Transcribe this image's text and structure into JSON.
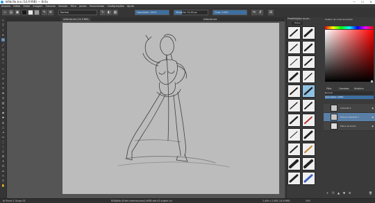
{
  "window": {
    "title": "rb9bc9a.kra (14,9 MiB) — Krita",
    "minimize": "—",
    "maximize": "☐",
    "close": "✕"
  },
  "menu": [
    "Arquivo",
    "Editar",
    "Exibir",
    "Imagem",
    "Camada",
    "Seleção",
    "Filtro",
    "Janela",
    "Ferramentas",
    "Configurações",
    "Ajuda"
  ],
  "toolbar": {
    "blend_mode": "Normal",
    "opacity": {
      "label": "Opacidade: 100%",
      "value": 1.0
    },
    "size": {
      "label": "Tamanho: 10,00 px",
      "value": 0.22
    },
    "flow": {
      "label": "Fluxo: 100%",
      "value": 1.0
    }
  },
  "tabs": [
    {
      "label": "rb9bc9a.kra (14,9 MiB)"
    },
    {
      "label": "rb9bc9a.kra"
    }
  ],
  "brush_panel": {
    "title": "Predefinições de pin...",
    "tag": "Todos"
  },
  "color_panel": {
    "title": "Seletor de cores avançado",
    "accent": "#ff0000"
  },
  "layers": {
    "tabs": [
      "Pilha",
      "Camadas",
      "Histórico"
    ],
    "blend": "Normal",
    "opacity_label": "Opacidade: 100%",
    "items": [
      {
        "name": "Camada 2",
        "selected": false
      },
      {
        "name": "Pintura Camada 1",
        "selected": true
      },
      {
        "name": "Plano de fundo",
        "selected": false
      }
    ]
  },
  "status": {
    "left": "b) Pincel 1 Grupo 02",
    "center": "RGB/Alfa (8 bits inteiros/canal)  sRGB-elle-V2-srgbtrc.icc",
    "right": "2.400 x 2.400 (14,9 MiB)",
    "zoom": "24%"
  }
}
